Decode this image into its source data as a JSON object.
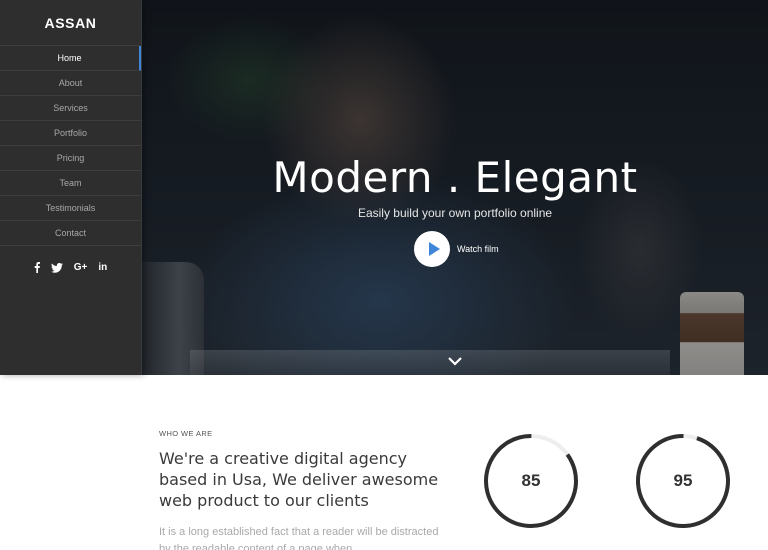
{
  "brand": {
    "name": "ASSAN"
  },
  "nav": {
    "items": [
      {
        "label": "Home",
        "active": true
      },
      {
        "label": "About",
        "active": false
      },
      {
        "label": "Services",
        "active": false
      },
      {
        "label": "Portfolio",
        "active": false
      },
      {
        "label": "Pricing",
        "active": false
      },
      {
        "label": "Team",
        "active": false
      },
      {
        "label": "Testimonials",
        "active": false
      },
      {
        "label": "Contact",
        "active": false
      }
    ],
    "socials": [
      {
        "icon": "facebook-icon",
        "glyph": "f"
      },
      {
        "icon": "twitter-icon",
        "glyph": "twitter"
      },
      {
        "icon": "google-plus-icon",
        "glyph": "G+"
      },
      {
        "icon": "linkedin-icon",
        "glyph": "in"
      }
    ]
  },
  "hero": {
    "title": "Modern . Elegant",
    "subtitle": "Easily build your own portfolio online",
    "watch_label": "Watch film",
    "play_icon": "play-icon",
    "scroll_icon": "chevron-down-icon"
  },
  "about": {
    "label": "WHO WE ARE",
    "heading": "We're a creative digital agency based in Usa, We deliver awesome web product to our clients",
    "body": "It is a long established fact that a reader will be distracted by the readable content of a page when"
  },
  "stats": [
    {
      "value": "85",
      "percent": 85
    },
    {
      "value": "95",
      "percent": 95
    }
  ],
  "colors": {
    "accent": "#3f86d8",
    "sidebar": "#2e2e2e",
    "ring": "#2f2f2f",
    "ring_track": "#eeeeee"
  }
}
